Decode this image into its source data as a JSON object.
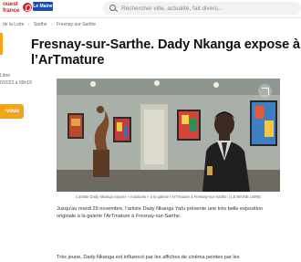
{
  "header": {
    "logo_text": "ouest france",
    "maine_badge": "Le Maine",
    "search_placeholder": "Rechercher ville, actualité, fait divers..."
  },
  "breadcrumb": {
    "items": [
      "de la Loire",
      "Sarthe",
      "Fresnay-sur-Sarthe"
    ]
  },
  "sidebar": {
    "meta_lines": [
      "Libre",
      "0/2022 à 09h19"
    ],
    "follow_label": "-vous"
  },
  "article": {
    "title": "Fresnay-sur-Sarthe. Dady Nkanga expose à l’ArTmature",
    "caption": "L’artiste Dady Nkanga expose « Intuitions » à la galerie l’ArTmature à Fresnay-sur-Sarthe. | LE MAINE LIBRE",
    "paragraph1": "Jusqu’au mardi 29 novembre, l’artiste Dady Nkanga Yafu présente une très belle exposition originale à la galerie l’ArTmature à Fresnay-sur-Sarthe.",
    "paragraph2": "Très jeune, Dady Nkanga est influencé par les affiches de cinéma peintes par les"
  },
  "colors": {
    "brand_red": "#d3222a",
    "follow_orange": "#f0a51d",
    "maine_blue": "#1e4fa8"
  },
  "icons": {
    "search": "search-icon",
    "expand": "expand-icon"
  }
}
